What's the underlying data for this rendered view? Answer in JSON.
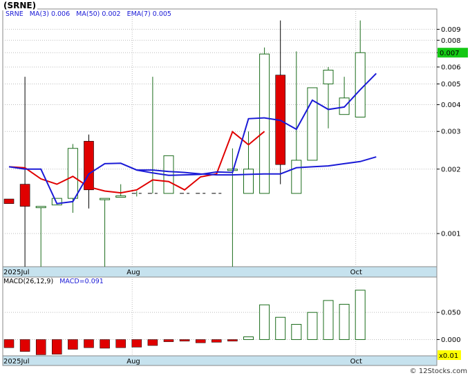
{
  "title": "(SRNE)",
  "legend": {
    "symbol": "SRNE",
    "ma3": "MA(3)",
    "ma3_value": "0.006",
    "ma50": "MA(50)",
    "ma50_value": "0.002",
    "ema7": "EMA(7)",
    "ema7_value": "0.005"
  },
  "macd_legend": {
    "label": "MACD(26,12,9)",
    "macd": "MACD=0.091"
  },
  "watermark": "© 12Stocks.com",
  "colors": {
    "up_candle": "#1a6b1a",
    "down_candle": "#e00000",
    "ma3": "#e00000",
    "ma50": "#1a1ad6",
    "ema7": "#1a1ad6",
    "axis_band": "#c6e2ee",
    "grid": "#bbbbbb",
    "last_price_badge": "#14c814",
    "multiplier_badge": "#ffff00"
  },
  "chart_data": [
    {
      "type": "candlestick",
      "y_scale": "log",
      "ylim": [
        0.0007,
        0.0112
      ],
      "y_ticks": [
        "0.009",
        "0.008",
        "0.007",
        "0.006",
        "0.005",
        "0.004",
        "0.003",
        "0.002",
        "0.001"
      ],
      "x_ticks": [
        {
          "label": "2025Jul",
          "index": 0
        },
        {
          "label": "Aug",
          "index": 8
        },
        {
          "label": "Oct",
          "index": 22
        }
      ],
      "last_price": "0.007",
      "candles": [
        {
          "o": 0.00145,
          "h": 0.00145,
          "l": 0.00138,
          "c": 0.00138,
          "dir": "down"
        },
        {
          "o": 0.0017,
          "h": 0.0054,
          "l": 0.0007,
          "c": 0.00134,
          "dir": "down"
        },
        {
          "o": 0.00134,
          "h": 0.00134,
          "l": 0.0007,
          "c": 0.00134,
          "dir": "up"
        },
        {
          "o": 0.00136,
          "h": 0.00146,
          "l": 0.00136,
          "c": 0.00146,
          "dir": "up"
        },
        {
          "o": 0.00146,
          "h": 0.00262,
          "l": 0.00125,
          "c": 0.0025,
          "dir": "up"
        },
        {
          "o": 0.0027,
          "h": 0.0029,
          "l": 0.00131,
          "c": 0.0016,
          "dir": "down"
        },
        {
          "o": 0.00146,
          "h": 0.00146,
          "l": 0.0007,
          "c": 0.00146,
          "dir": "up"
        },
        {
          "o": 0.0015,
          "h": 0.0017,
          "l": 0.00148,
          "c": 0.0015,
          "dir": "up"
        },
        {
          "o": 0.00154,
          "h": 0.00158,
          "l": 0.00149,
          "c": 0.00154,
          "dir": "flat"
        },
        {
          "o": 0.00154,
          "h": 0.0054,
          "l": 0.00154,
          "c": 0.00154,
          "dir": "flat"
        },
        {
          "o": 0.00154,
          "h": 0.00231,
          "l": 0.00154,
          "c": 0.00231,
          "dir": "up"
        },
        {
          "o": 0.00154,
          "h": 0.00154,
          "l": 0.00154,
          "c": 0.00154,
          "dir": "flat"
        },
        {
          "o": 0.00154,
          "h": 0.00154,
          "l": 0.00154,
          "c": 0.00154,
          "dir": "flat"
        },
        {
          "o": 0.00154,
          "h": 0.00154,
          "l": 0.00154,
          "c": 0.00154,
          "dir": "flat"
        },
        {
          "o": 0.002,
          "h": 0.0025,
          "l": 0.0007,
          "c": 0.002,
          "dir": "up"
        },
        {
          "o": 0.00154,
          "h": 0.003,
          "l": 0.00154,
          "c": 0.002,
          "dir": "up"
        },
        {
          "o": 0.00154,
          "h": 0.0074,
          "l": 0.00154,
          "c": 0.0069,
          "dir": "up"
        },
        {
          "o": 0.0055,
          "h": 0.0099,
          "l": 0.0017,
          "c": 0.0021,
          "dir": "down"
        },
        {
          "o": 0.00154,
          "h": 0.0071,
          "l": 0.00154,
          "c": 0.0022,
          "dir": "up"
        },
        {
          "o": 0.0022,
          "h": 0.0048,
          "l": 0.0022,
          "c": 0.0048,
          "dir": "up"
        },
        {
          "o": 0.005,
          "h": 0.006,
          "l": 0.0031,
          "c": 0.0058,
          "dir": "up"
        },
        {
          "o": 0.0036,
          "h": 0.0054,
          "l": 0.0036,
          "c": 0.0043,
          "dir": "up"
        },
        {
          "o": 0.0035,
          "h": 0.0099,
          "l": 0.0035,
          "c": 0.007,
          "dir": "up"
        }
      ],
      "ma3": [
        0.00205,
        0.00203,
        0.0018,
        0.0017,
        0.00185,
        0.00165,
        0.00158,
        0.00155,
        0.0016,
        0.00178,
        0.00175,
        0.0016,
        0.00184,
        0.0019,
        0.00299,
        0.0026,
        0.003
      ],
      "ma3_start_index": 0,
      "ma3_segment_break": 2,
      "ma50": [
        0.00198,
        0.00198,
        0.00195,
        0.00193,
        0.0019,
        0.00188,
        0.00188,
        0.00189,
        0.0019,
        0.0019,
        0.00203,
        0.00205,
        0.00207,
        0.00212,
        0.00217,
        0.00228
      ],
      "ema7": [
        0.00205,
        0.002,
        0.002,
        0.00138,
        0.00141,
        0.0019,
        0.00212,
        0.00213,
        0.00198,
        0.00192,
        0.00187,
        0.00188,
        0.00189,
        0.00194,
        0.00193,
        0.00344,
        0.00347,
        0.00338,
        0.00307,
        0.0042,
        0.0038,
        0.0039,
        0.0047,
        0.0056
      ]
    },
    {
      "type": "bar",
      "label": "MACD(26,12,9)",
      "ylim": [
        -0.03,
        0.105
      ],
      "y_ticks": [
        "0.050",
        "0.000"
      ],
      "multiplier": "x0.01",
      "x_ticks": [
        {
          "label": "2025Jul",
          "index": 0
        },
        {
          "label": "Aug",
          "index": 8
        },
        {
          "label": "Oct",
          "index": 22
        }
      ],
      "values": [
        -0.015,
        -0.022,
        -0.028,
        -0.027,
        -0.018,
        -0.015,
        -0.016,
        -0.015,
        -0.014,
        -0.011,
        -0.004,
        -0.003,
        -0.006,
        -0.005,
        -0.003,
        0.005,
        0.064,
        0.041,
        0.028,
        0.05,
        0.072,
        0.065,
        0.091
      ]
    }
  ]
}
